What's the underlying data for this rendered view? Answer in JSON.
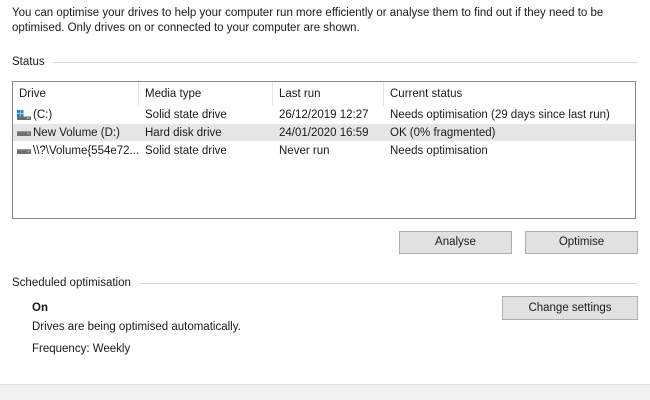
{
  "intro_text": "You can optimise your drives to help your computer run more efficiently or analyse them to find out if they need to be optimised. Only drives on or connected to your computer are shown.",
  "status": {
    "group_label": "Status",
    "columns": [
      "Drive",
      "Media type",
      "Last run",
      "Current status"
    ],
    "rows": [
      {
        "drive": "(C:)",
        "media": "Solid state drive",
        "last_run": "26/12/2019 12:27",
        "status": "Needs optimisation (29 days since last run)",
        "icon": "windows-drive-icon",
        "selected": false
      },
      {
        "drive": "New Volume (D:)",
        "media": "Hard disk drive",
        "last_run": "24/01/2020 16:59",
        "status": "OK (0% fragmented)",
        "icon": "hard-drive-icon",
        "selected": true
      },
      {
        "drive": "\\\\?\\Volume{554e72...",
        "media": "Solid state drive",
        "last_run": "Never run",
        "status": "Needs optimisation",
        "icon": "hard-drive-icon",
        "selected": false
      }
    ],
    "analyse_label": "Analyse",
    "optimise_label": "Optimise"
  },
  "scheduled": {
    "group_label": "Scheduled optimisation",
    "state": "On",
    "description": "Drives are being optimised automatically.",
    "frequency": "Frequency: Weekly",
    "change_settings_label": "Change settings"
  }
}
